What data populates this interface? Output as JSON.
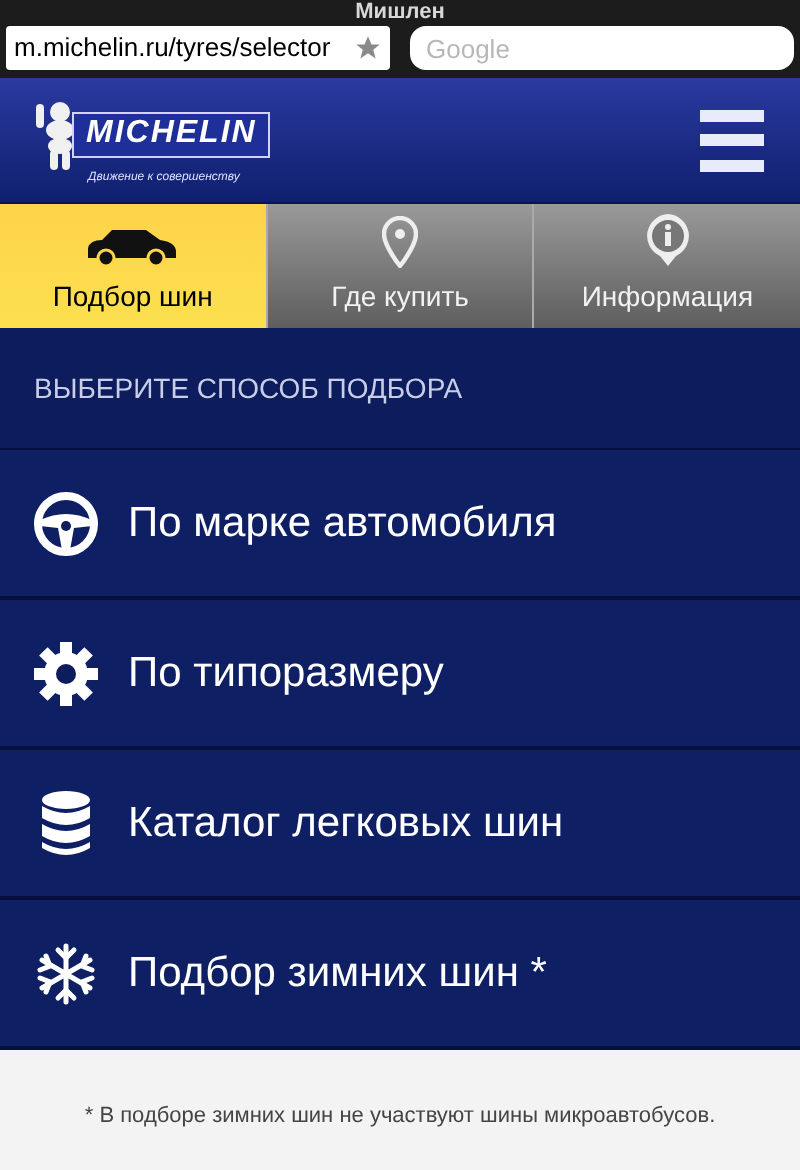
{
  "browser": {
    "title": "Мишлен",
    "url": "m.michelin.ru/tyres/selector",
    "search_placeholder": "Google"
  },
  "header": {
    "logo_text": "MICHELIN",
    "tagline": "Движение к совершенству"
  },
  "tabs": [
    {
      "label": "Подбор шин",
      "kind": "car",
      "selected": true
    },
    {
      "label": "Где купить",
      "kind": "pin",
      "selected": false
    },
    {
      "label": "Информация",
      "kind": "info",
      "selected": false
    }
  ],
  "section_title": "ВЫБЕРИТЕ СПОСОБ ПОДБОРА",
  "options": [
    {
      "label": "По марке автомобиля",
      "kind": "wheel"
    },
    {
      "label": "По типоразмеру",
      "kind": "gear"
    },
    {
      "label": "Каталог легковых шин",
      "kind": "database"
    },
    {
      "label": "Подбор зимних шин *",
      "kind": "snowflake"
    }
  ],
  "footnote": "* В подборе зимних шин не участвуют шины микроавтобусов."
}
